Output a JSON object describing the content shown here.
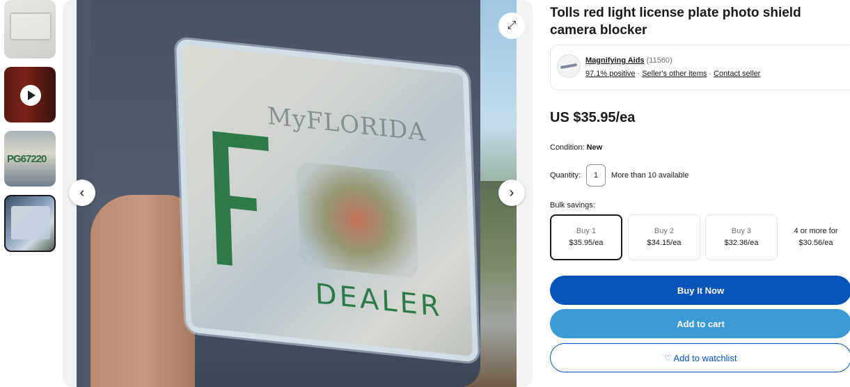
{
  "listing": {
    "title": "Tolls red light license plate photo shield camera blocker",
    "price": "US $35.95/ea",
    "condition_label": "Condition:",
    "condition_value": "New",
    "quantity_label": "Quantity:",
    "quantity_value": "1",
    "availability": "More than 10 available",
    "bulk_label": "Bulk savings:"
  },
  "seller": {
    "name": "Magnifying Aids",
    "feedback_count": "(11560)",
    "positive": "97.1% positive",
    "other_items": "Seller's other items",
    "contact": "Contact seller"
  },
  "bulk_options": [
    {
      "qty": "Buy 1",
      "price": "$35.95/ea",
      "selected": true
    },
    {
      "qty": "Buy 2",
      "price": "$34.15/ea",
      "selected": false
    },
    {
      "qty": "Buy 3",
      "price": "$32.36/ea",
      "selected": false
    },
    {
      "qty": "4 or more for",
      "price": "$30.56/ea",
      "selected": false
    }
  ],
  "buttons": {
    "buy_now": "Buy It Now",
    "add_to_cart": "Add to cart",
    "watchlist": "Add to watchlist"
  },
  "gallery": {
    "prev_icon": "‹",
    "next_icon": "›",
    "expand_icon": "⤢",
    "thumbnail_count": 4,
    "selected_thumbnail": 4,
    "plate_text_state": "MyFLORIDA",
    "plate_text_bottom": "DEALER",
    "thumb3_text": "PG67220"
  },
  "colors": {
    "primary_button": "#0654ba",
    "secondary_button": "#3c9bd4",
    "text": "#191919",
    "muted": "#707070"
  }
}
